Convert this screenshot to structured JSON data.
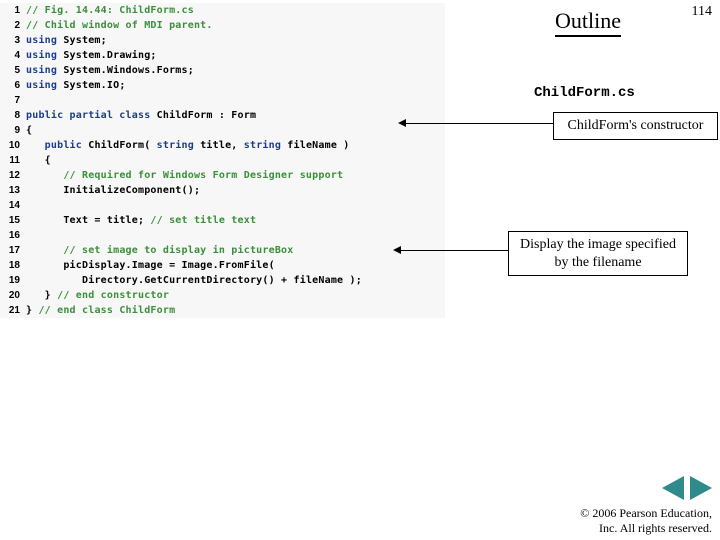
{
  "header": {
    "outline": "Outline",
    "pageNumber": "114",
    "filename": "ChildForm.cs"
  },
  "callouts": {
    "constructor": "ChildForm's constructor",
    "image": "Display the image specified by the filename"
  },
  "code": {
    "lines": [
      {
        "n": "1",
        "segs": [
          {
            "cls": "c-comment",
            "t": "// Fig. 14.44: ChildForm.cs"
          }
        ]
      },
      {
        "n": "2",
        "segs": [
          {
            "cls": "c-comment",
            "t": "// Child window of MDI parent."
          }
        ]
      },
      {
        "n": "3",
        "segs": [
          {
            "cls": "c-key",
            "t": "using "
          },
          {
            "cls": "c-id",
            "t": "System;"
          }
        ]
      },
      {
        "n": "4",
        "segs": [
          {
            "cls": "c-key",
            "t": "using "
          },
          {
            "cls": "c-id",
            "t": "System.Drawing;"
          }
        ]
      },
      {
        "n": "5",
        "segs": [
          {
            "cls": "c-key",
            "t": "using "
          },
          {
            "cls": "c-id",
            "t": "System.Windows.Forms;"
          }
        ]
      },
      {
        "n": "6",
        "segs": [
          {
            "cls": "c-key",
            "t": "using "
          },
          {
            "cls": "c-id",
            "t": "System.IO;"
          }
        ]
      },
      {
        "n": "7",
        "segs": []
      },
      {
        "n": "8",
        "segs": [
          {
            "cls": "c-key",
            "t": "public partial class "
          },
          {
            "cls": "c-id",
            "t": "ChildForm : Form"
          }
        ]
      },
      {
        "n": "9",
        "segs": [
          {
            "cls": "c-plain",
            "t": "{"
          }
        ]
      },
      {
        "n": "10",
        "segs": [
          {
            "cls": "c-plain",
            "t": "   "
          },
          {
            "cls": "c-key",
            "t": "public "
          },
          {
            "cls": "c-id",
            "t": "ChildForm( "
          },
          {
            "cls": "c-key",
            "t": "string "
          },
          {
            "cls": "c-id",
            "t": "title, "
          },
          {
            "cls": "c-key",
            "t": "string "
          },
          {
            "cls": "c-id",
            "t": "fileName )"
          }
        ]
      },
      {
        "n": "11",
        "segs": [
          {
            "cls": "c-plain",
            "t": "   {"
          }
        ]
      },
      {
        "n": "12",
        "segs": [
          {
            "cls": "c-plain",
            "t": "      "
          },
          {
            "cls": "c-comment",
            "t": "// Required for Windows Form Designer support"
          }
        ]
      },
      {
        "n": "13",
        "segs": [
          {
            "cls": "c-plain",
            "t": "      "
          },
          {
            "cls": "c-id",
            "t": "InitializeComponent();"
          }
        ]
      },
      {
        "n": "14",
        "segs": []
      },
      {
        "n": "15",
        "segs": [
          {
            "cls": "c-plain",
            "t": "      "
          },
          {
            "cls": "c-id",
            "t": "Text = title; "
          },
          {
            "cls": "c-comment",
            "t": "// set title text"
          }
        ]
      },
      {
        "n": "16",
        "segs": []
      },
      {
        "n": "17",
        "segs": [
          {
            "cls": "c-plain",
            "t": "      "
          },
          {
            "cls": "c-comment",
            "t": "// set image to display in pictureBox"
          }
        ]
      },
      {
        "n": "18",
        "segs": [
          {
            "cls": "c-plain",
            "t": "      "
          },
          {
            "cls": "c-id",
            "t": "picDisplay.Image = Image.FromFile("
          }
        ]
      },
      {
        "n": "19",
        "segs": [
          {
            "cls": "c-plain",
            "t": "         "
          },
          {
            "cls": "c-id",
            "t": "Directory.GetCurrentDirectory() + fileName );"
          }
        ]
      },
      {
        "n": "20",
        "segs": [
          {
            "cls": "c-plain",
            "t": "   } "
          },
          {
            "cls": "c-comment",
            "t": "// end constructor"
          }
        ]
      },
      {
        "n": "21",
        "segs": [
          {
            "cls": "c-plain",
            "t": "} "
          },
          {
            "cls": "c-comment",
            "t": "// end class ChildForm"
          }
        ]
      }
    ]
  },
  "footer": {
    "copyright1": "© 2006 Pearson Education,",
    "copyright2": "Inc.  All rights reserved."
  }
}
